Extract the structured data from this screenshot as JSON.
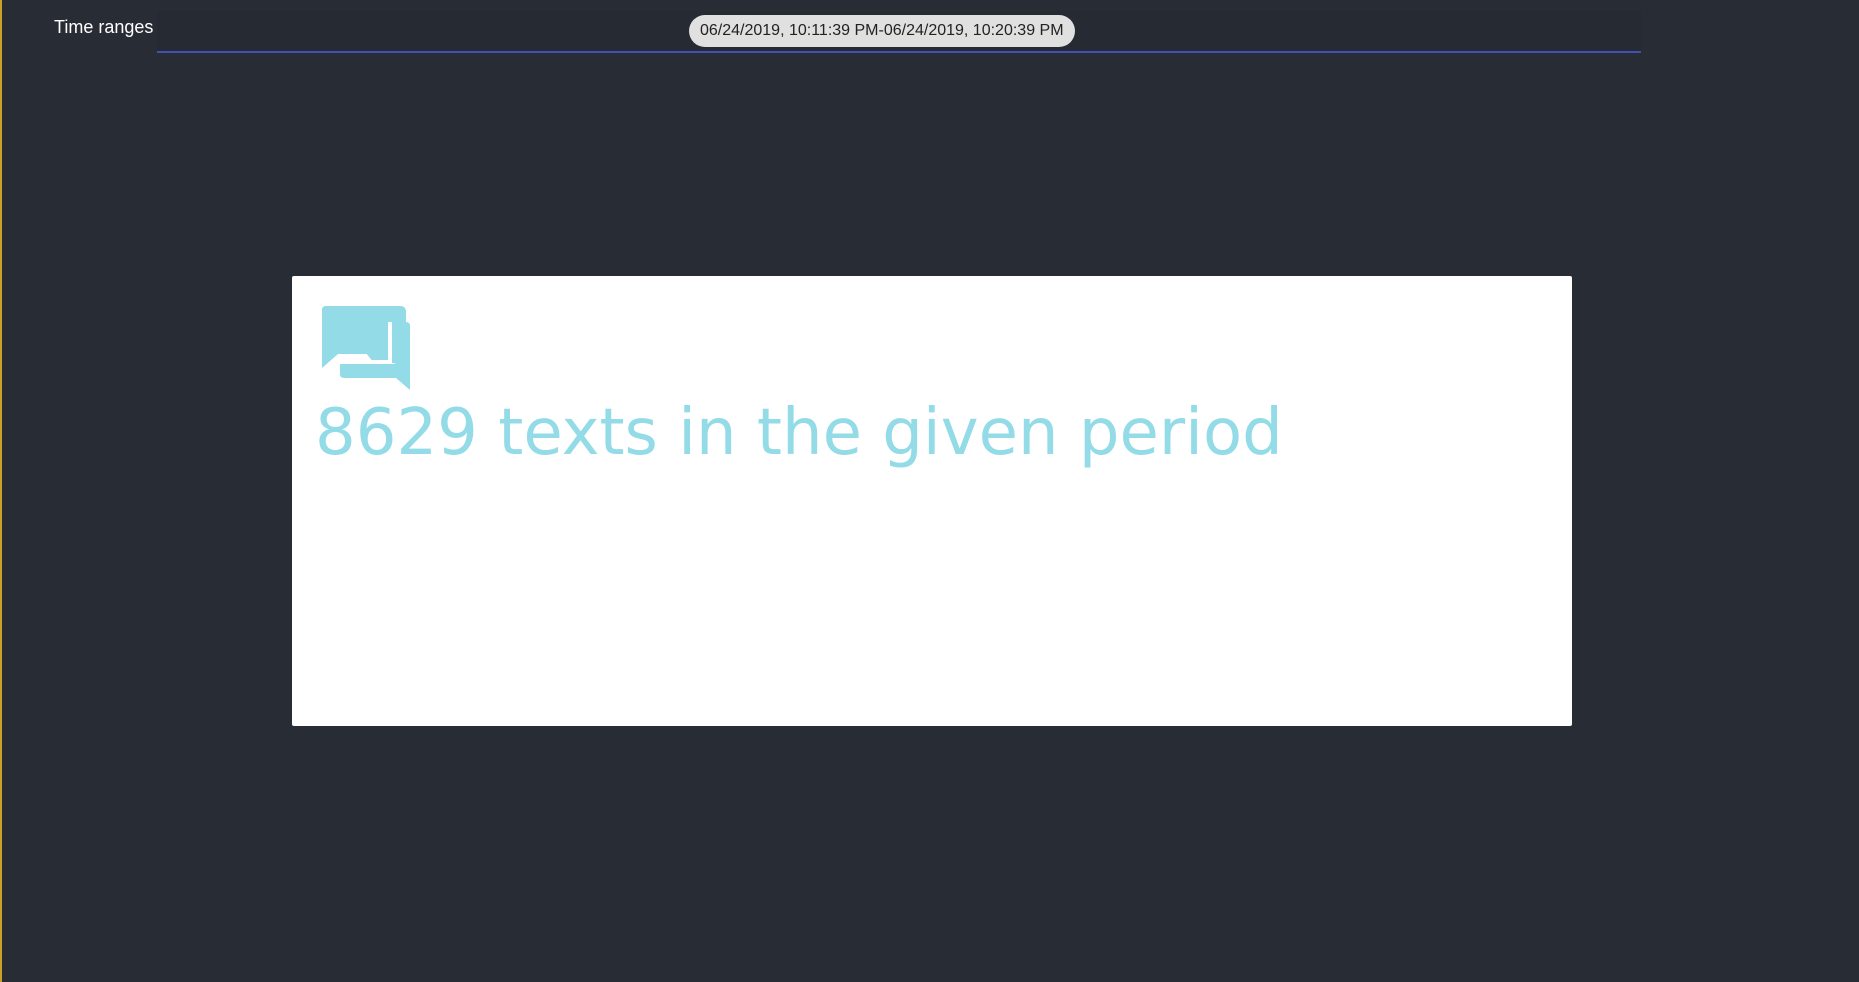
{
  "header": {
    "label": "Time ranges"
  },
  "time_range": {
    "chip_label": "06/24/2019, 10:11:39 PM-06/24/2019, 10:20:39 PM"
  },
  "card": {
    "icon": "chat-bubbles-icon",
    "summary_text": "8629 texts in the given period",
    "accent_color": "#93dbe7"
  },
  "colors": {
    "background": "#282c34",
    "underline": "#3f51b5",
    "chip": "#e0e0e0"
  }
}
